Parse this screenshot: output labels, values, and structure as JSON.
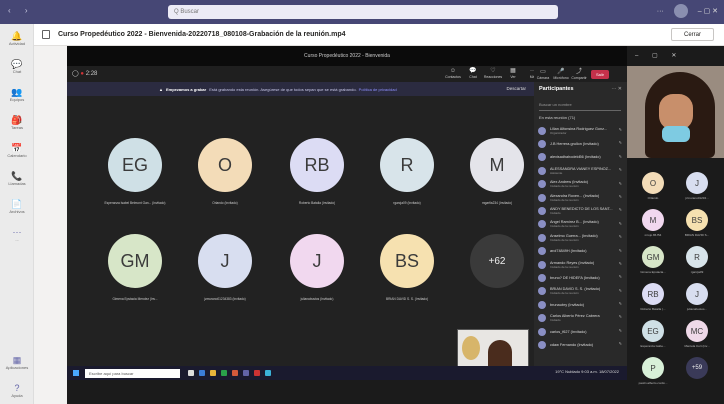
{
  "titlebar": {
    "search_placeholder": "Q Buscar"
  },
  "rail": {
    "items": [
      {
        "label": "Actividad",
        "icon": "bell-icon",
        "glyph": "🔔"
      },
      {
        "label": "Chat",
        "icon": "chat-icon",
        "glyph": "💬"
      },
      {
        "label": "Equipos",
        "icon": "teams-icon",
        "glyph": "👥"
      },
      {
        "label": "Tareas",
        "icon": "backpack-icon",
        "glyph": "🎒"
      },
      {
        "label": "Calendario",
        "icon": "calendar-icon",
        "glyph": "📅"
      },
      {
        "label": "Llamadas",
        "icon": "phone-icon",
        "glyph": "📞"
      },
      {
        "label": "Archivos",
        "icon": "file-icon",
        "glyph": "📄"
      },
      {
        "label": "...",
        "icon": "more-icon",
        "glyph": "···"
      }
    ],
    "bottom": [
      {
        "label": "Aplicaciones",
        "icon": "apps-icon",
        "glyph": "▦"
      },
      {
        "label": "Ayuda",
        "icon": "help-icon",
        "glyph": "?"
      }
    ]
  },
  "header": {
    "title": "Curso Propedéutico 2022 - Bienvenida-20220718_080108-Grabación de la reunión.mp4",
    "close_label": "Cerrar"
  },
  "video": {
    "window_title": "Curso Propedéutico 2022 - Bienvenida",
    "timer": "2:28",
    "tools": [
      "Contactos",
      "Chat",
      "Reacciones",
      "Ver",
      "Más"
    ],
    "tools2": [
      "Cámara",
      "Micrófono",
      "Compartir"
    ],
    "leave_label": "Salir",
    "banner_bold": "Empezamos a grabar",
    "banner_text": "Está grabando esta reunión. Asegúrese de que todos sepan que se está grabando.",
    "banner_link": "Política de privacidad",
    "dismiss_label": "Descartar",
    "tiles": [
      {
        "initials": "EG",
        "name": "Esperanza Isabel Belmont Gan... (Invitado)",
        "color": "#cfe0e6"
      },
      {
        "initials": "O",
        "name": "Orlando (Invitado)",
        "color": "#f3dcb8"
      },
      {
        "initials": "RB",
        "name": "Roberto Batalla (Invitado)",
        "color": "#dcdcf4"
      },
      {
        "initials": "R",
        "name": "rgarcja09 (Invitado)",
        "color": "#d8e4ea"
      },
      {
        "initials": "M",
        "name": "mgarfia234 (Invitado)",
        "color": "#e4e4ea"
      },
      {
        "initials": "GM",
        "name": "Gimena Epstacia Mendez (Inv...",
        "color": "#d7e6c8"
      },
      {
        "initials": "J",
        "name": "jzmurano01234383 (Invitado)",
        "color": "#d8def0"
      },
      {
        "initials": "J",
        "name": "julianabustos (Invitado)",
        "color": "#f1d8ef"
      },
      {
        "initials": "BS",
        "name": "BRIAN DAVID S. S. (Invitado)",
        "color": "#f6e1b0"
      },
      {
        "initials": "+62",
        "name": "",
        "color": "#3a3a3a"
      }
    ],
    "taskbar_search": "Escribe aquí para buscar",
    "tray_text": "19°C Nublado  9:03 a.m.  18/07/2022"
  },
  "panel": {
    "title": "Participantes",
    "search_placeholder": "Buscar un nombre",
    "section": "En esta reunión (71)",
    "participants": [
      {
        "name": "Lilian Alfonsina Rodríguez Gonz...",
        "sub": "Organizador"
      },
      {
        "name": "J.B Herrera.grullon (Invitado)",
        "sub": ""
      },
      {
        "name": "alexisadhahodeld56 (Invitado)",
        "sub": ""
      },
      {
        "name": "ALESSANDRA VIANEY ESPINOZ...",
        "sub": "Asistente"
      },
      {
        "name": "Alex Andrew (Invitado)",
        "sub": "Invitado de la reunión"
      },
      {
        "name": "Alexandra Roxen... (Invitado)",
        "sub": "Invitado de la reunión"
      },
      {
        "name": "ANDY BENEDICTO DE LOS SANT...",
        "sub": "Invitado"
      },
      {
        "name": "Ángel Ramírez B... (Invitado)",
        "sub": "Invitado de la reunión"
      },
      {
        "name": "Anselmo Guerra... (Invitado)",
        "sub": "Invitado de la reunión"
      },
      {
        "name": "arol74849H (Invitado)",
        "sub": ""
      },
      {
        "name": "Armando Reyes (Invitado)",
        "sub": "Invitado de la reunión"
      },
      {
        "name": "bruno? DE HIDEFA (Invitado)",
        "sub": ""
      },
      {
        "name": "BRIAN DAVID S. S. (Invitado)",
        "sub": "Invitado de la reunión"
      },
      {
        "name": "brunaubry (Invitado)",
        "sub": ""
      },
      {
        "name": "Carlos Alberto Pérez Cabrera",
        "sub": "Invitado"
      },
      {
        "name": "carlos_f627 (Invitado)",
        "sub": ""
      },
      {
        "name": "cdaw Fernando (Invitado)",
        "sub": ""
      }
    ]
  },
  "mini_tiles": [
    {
      "initials": "O",
      "name": "Orlando",
      "color": "#f3dcb8"
    },
    {
      "initials": "J",
      "name": "jzmurano01234...",
      "color": "#d8def0"
    },
    {
      "initials": "M",
      "name": "mrojo.86.f54",
      "color": "#f1d8ef"
    },
    {
      "initials": "BS",
      "name": "BRIAN DAVID S...",
      "color": "#f6e1b0"
    },
    {
      "initials": "GM",
      "name": "Gimena Epstacia...",
      "color": "#d7e6c8"
    },
    {
      "initials": "R",
      "name": "rgarcja09",
      "color": "#d8e4ea"
    },
    {
      "initials": "RB",
      "name": "Roberto Batalla (...",
      "color": "#dcdcf4"
    },
    {
      "initials": "J",
      "name": "julianabustos...",
      "color": "#d8def0"
    },
    {
      "initials": "EG",
      "name": "Esperanza Isabe...",
      "color": "#cfe0e6"
    },
    {
      "initials": "MC",
      "name": "Marcela Cort (inv...",
      "color": "#efd9e8"
    },
    {
      "initials": "P",
      "name": "paolin.alberto.cordo...",
      "color": "#d8f0d8"
    },
    {
      "initials": "+59",
      "name": "",
      "color": "#3a3a58"
    }
  ]
}
